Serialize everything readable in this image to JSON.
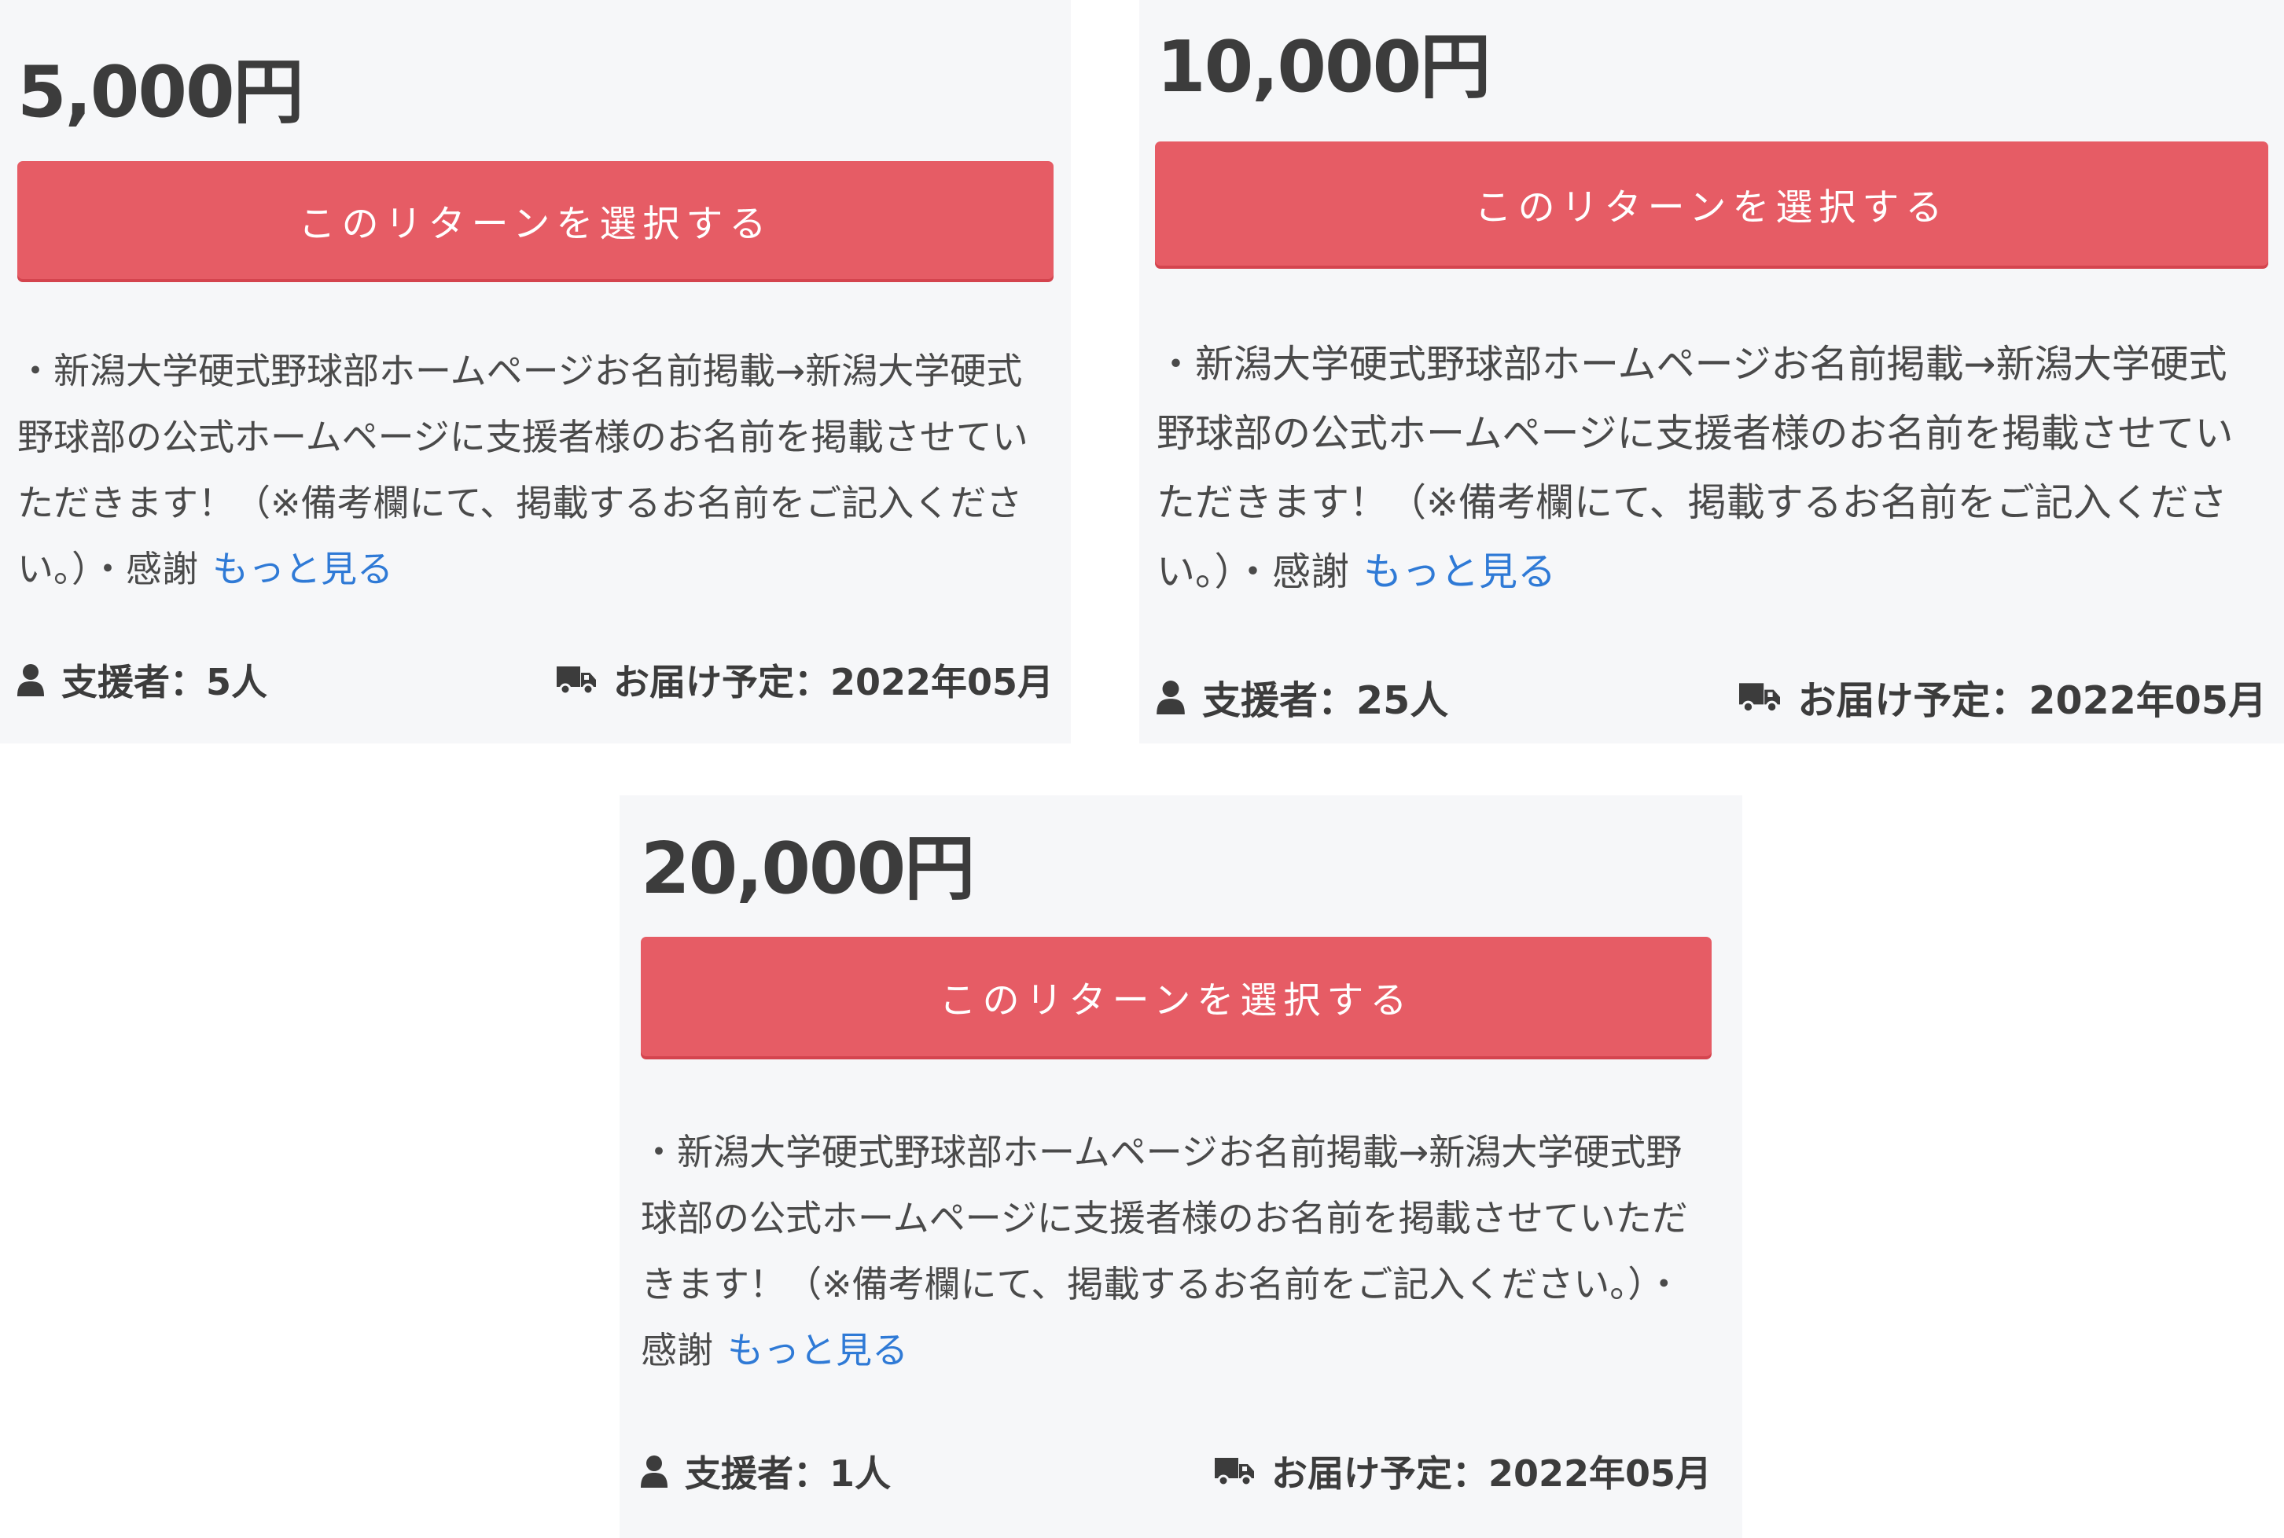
{
  "cards": [
    {
      "price": "5,000円",
      "button_label": "このリターンを選択する",
      "description": "・新潟大学硬式野球部ホームページお名前掲載→新潟大学硬式野球部の公式ホームページに支援者様のお名前を掲載させていただきます！（※備考欄にて、掲載するお名前をご記入ください。）・感謝",
      "more_label": "もっと見る",
      "supporters": "支援者：5人",
      "delivery": "お届け予定：2022年05月",
      "supporter_icon": "user-icon",
      "delivery_icon": "truck-icon"
    },
    {
      "price": "10,000円",
      "button_label": "このリターンを選択する",
      "description": "・新潟大学硬式野球部ホームページお名前掲載→新潟大学硬式野球部の公式ホームページに支援者様のお名前を掲載させていただきます！（※備考欄にて、掲載するお名前をご記入ください。）・感謝",
      "more_label": "もっと見る",
      "supporters": "支援者：25人",
      "delivery": "お届け予定：2022年05月",
      "supporter_icon": "user-icon",
      "delivery_icon": "truck-icon"
    },
    {
      "price": "20,000円",
      "button_label": "このリターンを選択する",
      "description": "・新潟大学硬式野球部ホームページお名前掲載→新潟大学硬式野球部の公式ホームページに支援者様のお名前を掲載させていただきます！（※備考欄にて、掲載するお名前をご記入ください。）・感謝",
      "more_label": "もっと見る",
      "supporters": "支援者：1人",
      "delivery": "お届け予定：2022年05月",
      "supporter_icon": "user-icon",
      "delivery_icon": "truck-icon"
    }
  ],
  "colors": {
    "card_background": "#f6f7f9",
    "button": "#e65c65",
    "link": "#2f7ad6",
    "text": "#3c3c3c"
  }
}
